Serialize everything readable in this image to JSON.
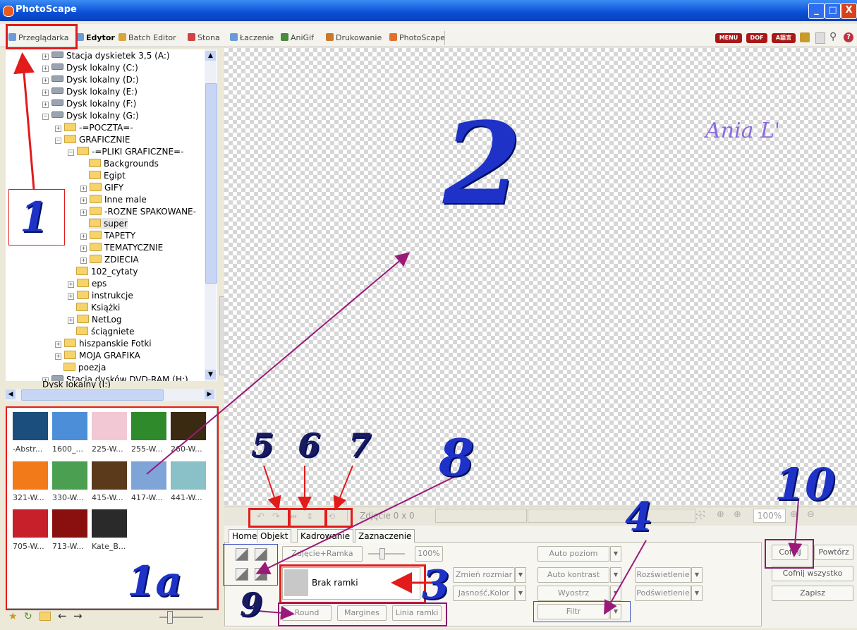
{
  "window": {
    "title": "PhotoScape",
    "controls": [
      "_",
      "□",
      "X"
    ]
  },
  "tabs": [
    {
      "label": "Przeglądarka",
      "selected": false
    },
    {
      "label": "Edytor",
      "selected": true
    },
    {
      "label": "Batch Editor",
      "selected": false
    },
    {
      "label": "Stona",
      "selected": false
    },
    {
      "label": "Łaczenie",
      "selected": false
    },
    {
      "label": "AniGif",
      "selected": false
    },
    {
      "label": "Drukowanie",
      "selected": false
    },
    {
      "label": "PhotoScape",
      "selected": false
    }
  ],
  "top_icons": [
    "MENU",
    "DOF",
    "A語言"
  ],
  "tree": [
    "Stacja dyskietek 3,5 (A:)",
    "Dysk lokalny (C:)",
    "Dysk lokalny (D:)",
    "Dysk lokalny (E:)",
    "Dysk lokalny (F:)",
    "Dysk lokalny (G:)",
    "-=POCZTA=-",
    "GRAFICZNIE",
    "-=PLIKI GRAFICZNE=-",
    "Backgrounds",
    "Egipt",
    "GIFY",
    "Inne male",
    "-ROZNE SPAKOWANE-",
    "super",
    "TAPETY",
    "TEMATYCZNIE",
    "ZDIECIA",
    "102_cytaty",
    "eps",
    "instrukcje",
    "Książki",
    "NetLog",
    "ściągniete",
    "hiszpanskie Fotki",
    "MOJA GRAFIKA",
    "poezja",
    "Stacja dysków DVD-RAM (H:)",
    "Dysk lokalny (I:)"
  ],
  "thumbnails": [
    {
      "caption": "-Abstr...",
      "color": "#1b4e7c"
    },
    {
      "caption": "1600_...",
      "color": "#4c8fd8"
    },
    {
      "caption": "225-W...",
      "color": "#f2c8d4"
    },
    {
      "caption": "255-W...",
      "color": "#2f8a2c"
    },
    {
      "caption": "260-W...",
      "color": "#3a2a12"
    },
    {
      "caption": "321-W...",
      "color": "#f27a18"
    },
    {
      "caption": "330-W...",
      "color": "#4aa050"
    },
    {
      "caption": "415-W...",
      "color": "#5a3a1a"
    },
    {
      "caption": "417-W...",
      "color": "#7ea4d8"
    },
    {
      "caption": "441-W...",
      "color": "#8ac0c8"
    },
    {
      "caption": "705-W...",
      "color": "#c8202a"
    },
    {
      "caption": "713-W...",
      "color": "#8a1010"
    },
    {
      "caption": "Kate_B...",
      "color": "#2a2a2a"
    }
  ],
  "canvas": {
    "signature": "Ania L'"
  },
  "status": {
    "size": "Zdjęcie 0 x 0",
    "zoom": "100%"
  },
  "panel_tabs": [
    "Home",
    "Objekt",
    "Kadrowanie",
    "Zaznaczenie"
  ],
  "buttons": {
    "photo_frame": "Zdjęcie+Ramka",
    "frame_pct": "100%",
    "frame_name": "Brak ramki",
    "round": "Round",
    "margins": "Margines",
    "frame_line": "Linia ramki",
    "resize": "Zmień rozmiar",
    "brightness": "Jasność,Kolor",
    "auto_level": "Auto poziom",
    "auto_contrast": "Auto kontrast",
    "sharpen": "Wyostrz",
    "filter": "Filtr",
    "lighten": "Rozświetlenie",
    "backlight": "Podświetlenie",
    "undo": "Cofnij",
    "redo": "Powtórz",
    "undo_all": "Cofnij wszystko",
    "save": "Zapisz"
  },
  "annotations": {
    "n1": "1",
    "n1a": "1a",
    "n2": "2",
    "n3": "3",
    "n4": "4",
    "n5": "5",
    "n6": "6",
    "n7": "7",
    "n8": "8",
    "n9": "9",
    "n10": "10"
  }
}
